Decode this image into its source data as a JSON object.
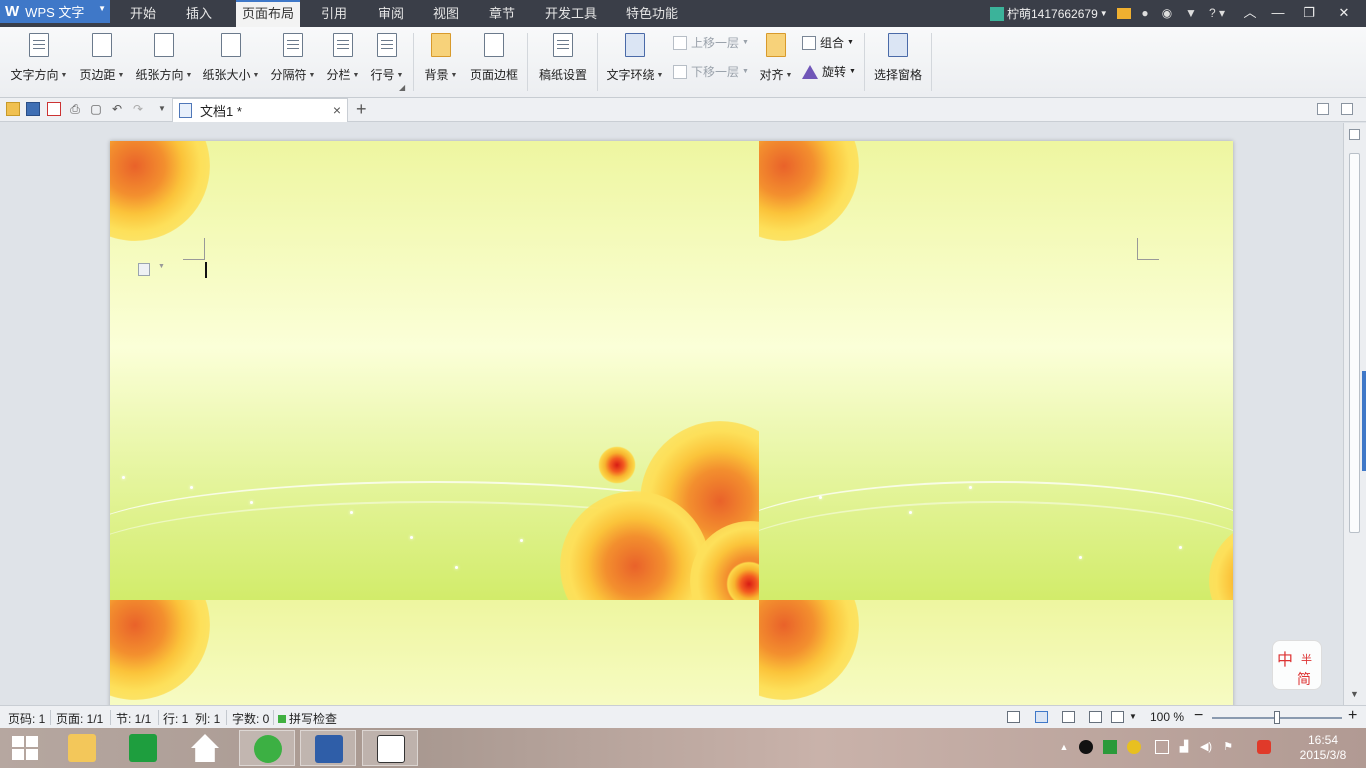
{
  "app": {
    "name": "WPS 文字",
    "menu_tabs": [
      "开始",
      "插入",
      "页面布局",
      "引用",
      "审阅",
      "视图",
      "章节",
      "开发工具",
      "特色功能"
    ],
    "active_tab": "页面布局",
    "user": "柠萌1417662679",
    "accent_color": "#3f78c8"
  },
  "ribbon": {
    "text_direction": "文字方向",
    "margins": "页边距",
    "orientation": "纸张方向",
    "paper_size": "纸张大小",
    "breaks": "分隔符",
    "columns": "分栏",
    "line_numbers": "行号",
    "background": "背景",
    "page_border": "页面边框",
    "manuscript": "稿纸设置",
    "text_wrap": "文字环绕",
    "bring_forward": "上移一层",
    "send_backward": "下移一层",
    "align": "对齐",
    "group": "组合",
    "rotate": "旋转",
    "selection_pane": "选择窗格"
  },
  "document": {
    "tab_title": "文档1 *"
  },
  "status": {
    "page_num": "页码: 1",
    "pages": "页面: 1/1",
    "section": "节: 1/1",
    "row": "行: 1",
    "col": "列: 1",
    "word_count": "字数: 0",
    "spell_check": "拼写检查",
    "zoom": "100 %"
  },
  "ime": {
    "char1": "中",
    "char2": "半",
    "char3": "简"
  },
  "taskbar": {
    "time": "16:54",
    "date": "2015/3/8"
  }
}
